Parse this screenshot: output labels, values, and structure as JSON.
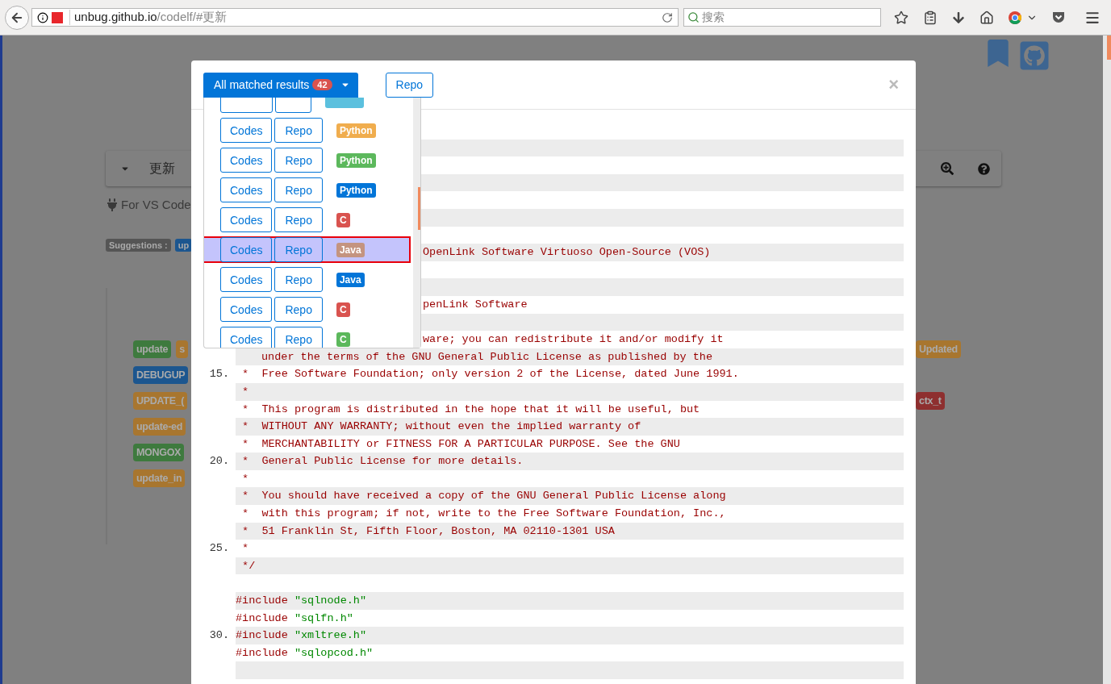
{
  "browser": {
    "url_host": "unbug.github.io",
    "url_path": "/codelf/#更新",
    "search_placeholder": "搜索"
  },
  "page": {
    "query": "更新",
    "plugin_note": "For VS Code",
    "suggestions_label": "Suggestions :",
    "suggestions": [
      {
        "text": "up",
        "color": "#1c568f"
      }
    ],
    "result_rows": [
      {
        "left": [
          {
            "text": "update",
            "color": "#3e7a3e"
          },
          {
            "text": "s",
            "color": "#a8762f"
          }
        ],
        "right": [
          {
            "text": "Updated",
            "color": "#a8762f"
          }
        ]
      },
      {
        "left": [
          {
            "text": "DEBUGUP",
            "color": "#1c568f"
          }
        ]
      },
      {
        "left": [
          {
            "text": "UPDATE_(",
            "color": "#a8762f"
          }
        ],
        "right": [
          {
            "text": "ctx_t",
            "color": "#8e2f2f"
          }
        ]
      },
      {
        "left": [
          {
            "text": "update-ed",
            "color": "#a8762f"
          }
        ]
      },
      {
        "left": [
          {
            "text": "MONGOX",
            "color": "#3e7a3e"
          }
        ]
      },
      {
        "left": [
          {
            "text": "update_in",
            "color": "#a8762f"
          }
        ]
      }
    ]
  },
  "modal": {
    "filter_label": "All matched results",
    "filter_count": "42",
    "repo_label": "Repo",
    "close": "×",
    "results": [
      {
        "kind": "clipped",
        "color": "#5bc0de",
        "selected": false
      },
      {
        "codes": "Codes",
        "repo": "Repo",
        "language": "Python",
        "color": "#f0ad4e",
        "selected": false
      },
      {
        "codes": "Codes",
        "repo": "Repo",
        "language": "Python",
        "color": "#5cb85c",
        "selected": false
      },
      {
        "codes": "Codes",
        "repo": "Repo",
        "language": "Python",
        "color": "#0275d8",
        "selected": false
      },
      {
        "codes": "Codes",
        "repo": "Repo",
        "language": "C",
        "color": "#d9534f",
        "selected": false
      },
      {
        "codes": "Codes",
        "repo": "Repo",
        "language": "Java",
        "color": "#c49480",
        "selected": true
      },
      {
        "codes": "Codes",
        "repo": "Repo",
        "language": "Java",
        "color": "#0275d8",
        "selected": false
      },
      {
        "codes": "Codes",
        "repo": "Repo",
        "language": "C",
        "color": "#d9534f",
        "selected": false
      },
      {
        "codes": "Codes",
        "repo": "Repo",
        "language": "C",
        "color": "#5cb85c",
        "selected": false
      }
    ],
    "code_lines": [
      {
        "kind": "blank"
      },
      {
        "kind": "blank"
      },
      {
        "kind": "blank"
      },
      {
        "kind": "blank"
      },
      {
        "kind": "blank"
      },
      {
        "kind": "blank"
      },
      {
        "kind": "blank"
      },
      {
        "kind": "after-menu",
        "text": "OpenLink Software Virtuoso Open-Source (VOS)"
      },
      {
        "kind": "blank"
      },
      {
        "kind": "blank"
      },
      {
        "kind": "after-menu",
        "text": "penLink Software"
      },
      {
        "kind": "blank"
      },
      {
        "kind": "after-menu",
        "text": "ware; you can redistribute it and/or modify it"
      },
      {
        "kind": "continued",
        "text": "under the terms of the GNU General Public License as published by the"
      },
      {
        "kind": "comment",
        "number": "15.",
        "text": " *  Free Software Foundation; only version 2 of the License, dated June 1991."
      },
      {
        "kind": "comment",
        "text": " *"
      },
      {
        "kind": "comment",
        "text": " *  This program is distributed in the hope that it will be useful, but"
      },
      {
        "kind": "comment",
        "text": " *  WITHOUT ANY WARRANTY; without even the implied warranty of"
      },
      {
        "kind": "comment",
        "text": " *  MERCHANTABILITY or FITNESS FOR A PARTICULAR PURPOSE. See the GNU"
      },
      {
        "kind": "comment",
        "number": "20.",
        "text": " *  General Public License for more details."
      },
      {
        "kind": "comment",
        "text": " *"
      },
      {
        "kind": "comment",
        "text": " *  You should have received a copy of the GNU General Public License along"
      },
      {
        "kind": "comment",
        "text": " *  with this program; if not, write to the Free Software Foundation, Inc.,"
      },
      {
        "kind": "comment",
        "text": " *  51 Franklin St, Fifth Floor, Boston, MA 02110-1301 USA"
      },
      {
        "kind": "comment",
        "number": "25.",
        "text": " *"
      },
      {
        "kind": "comment",
        "text": " */"
      },
      {
        "kind": "blank"
      },
      {
        "kind": "include",
        "text": "#include ",
        "string": "\"sqlnode.h\""
      },
      {
        "kind": "include",
        "text": "#include ",
        "string": "\"sqlfn.h\""
      },
      {
        "kind": "include",
        "number": "30.",
        "text": "#include ",
        "string": "\"xmltree.h\""
      },
      {
        "kind": "include",
        "text": "#include ",
        "string": "\"sqlopcod.h\""
      },
      {
        "kind": "blank"
      }
    ]
  }
}
